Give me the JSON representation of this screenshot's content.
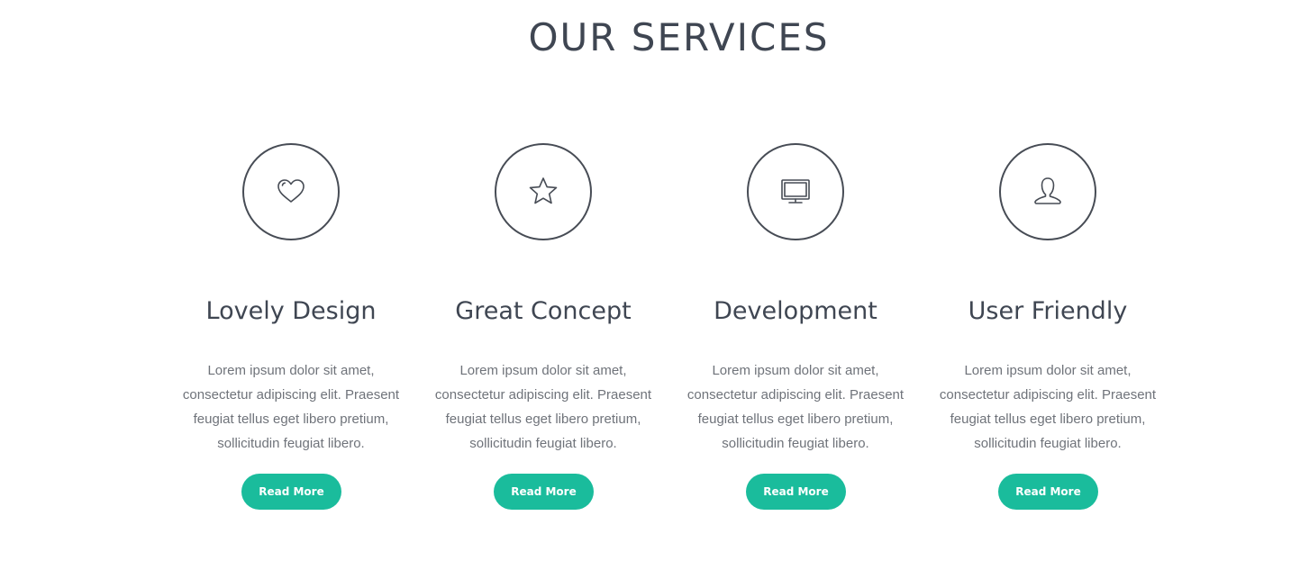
{
  "section": {
    "title": "OUR SERVICES"
  },
  "colors": {
    "heading": "#3f4652",
    "body_text": "#6f737a",
    "icon_stroke": "#474c55",
    "accent": "#1abc9c"
  },
  "services": [
    {
      "icon": "heart-icon",
      "title": "Lovely Design",
      "text": "Lorem ipsum dolor sit amet, consectetur adipiscing elit. Praesent feugiat tellus eget libero pretium, sollicitudin feugiat libero.",
      "button_label": "Read More"
    },
    {
      "icon": "star-icon",
      "title": "Great Concept",
      "text": "Lorem ipsum dolor sit amet, consectetur adipiscing elit. Praesent feugiat tellus eget libero pretium, sollicitudin feugiat libero.",
      "button_label": "Read More"
    },
    {
      "icon": "monitor-icon",
      "title": "Development",
      "text": "Lorem ipsum dolor sit amet, consectetur adipiscing elit. Praesent feugiat tellus eget libero pretium, sollicitudin feugiat libero.",
      "button_label": "Read More"
    },
    {
      "icon": "user-icon",
      "title": "User Friendly",
      "text": "Lorem ipsum dolor sit amet, consectetur adipiscing elit. Praesent feugiat tellus eget libero pretium, sollicitudin feugiat libero.",
      "button_label": "Read More"
    }
  ]
}
